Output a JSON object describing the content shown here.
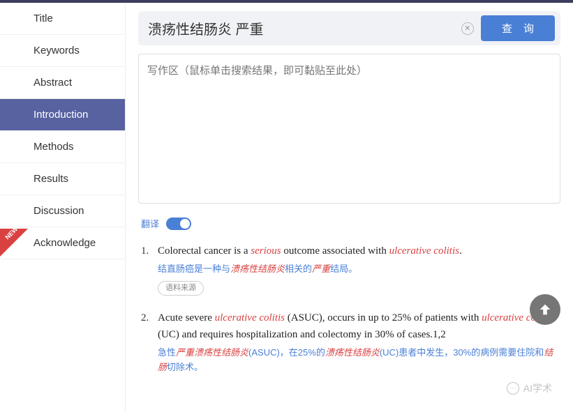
{
  "sidebar": {
    "items": [
      {
        "label": "Title"
      },
      {
        "label": "Keywords"
      },
      {
        "label": "Abstract"
      },
      {
        "label": "Introduction"
      },
      {
        "label": "Methods"
      },
      {
        "label": "Results"
      },
      {
        "label": "Discussion"
      },
      {
        "label": "Acknowledge"
      }
    ],
    "activeIndex": 3,
    "newBadge": "NEW"
  },
  "search": {
    "value": "溃疡性结肠炎 严重",
    "queryBtn": "查 询"
  },
  "writingArea": {
    "placeholder": "写作区（鼠标单击搜索结果，即可黏贴至此处）"
  },
  "translate": {
    "label": "翻译",
    "on": true
  },
  "results": [
    {
      "num": "1.",
      "en_parts": [
        {
          "t": "Colorectal cancer is a ",
          "hl": false
        },
        {
          "t": "serious",
          "hl": true
        },
        {
          "t": " outcome associated with ",
          "hl": false
        },
        {
          "t": "ulcerative colitis",
          "hl": true
        },
        {
          "t": ".",
          "hl": false
        }
      ],
      "zh_parts": [
        {
          "t": "结直肠癌是一种与",
          "hl": false
        },
        {
          "t": "溃疡性结肠炎",
          "hl": true
        },
        {
          "t": "相关的",
          "hl": false
        },
        {
          "t": "严重",
          "hl": true
        },
        {
          "t": "结局。",
          "hl": false
        }
      ],
      "source": "语料来源"
    },
    {
      "num": "2.",
      "en_parts": [
        {
          "t": "Acute severe ",
          "hl": false
        },
        {
          "t": "ulcerative colitis",
          "hl": true
        },
        {
          "t": " (ASUC), occurs in up to 25% of patients with ",
          "hl": false
        },
        {
          "t": "ulcerative colitis",
          "hl": true
        },
        {
          "t": " (UC) and requires hospitalization and colectomy in 30% of cases.1,2",
          "hl": false
        }
      ],
      "zh_parts": [
        {
          "t": "急性",
          "hl": false
        },
        {
          "t": "严重溃疡性结肠炎",
          "hl": true
        },
        {
          "t": "(ASUC)，在25%的",
          "hl": false
        },
        {
          "t": "溃疡性结肠炎",
          "hl": true
        },
        {
          "t": "(UC)患者中发生，30%的病例需要住院和",
          "hl": false
        },
        {
          "t": "结肠",
          "hl": true
        },
        {
          "t": "切除术。",
          "hl": false
        }
      ]
    }
  ],
  "watermark": "AI学术"
}
